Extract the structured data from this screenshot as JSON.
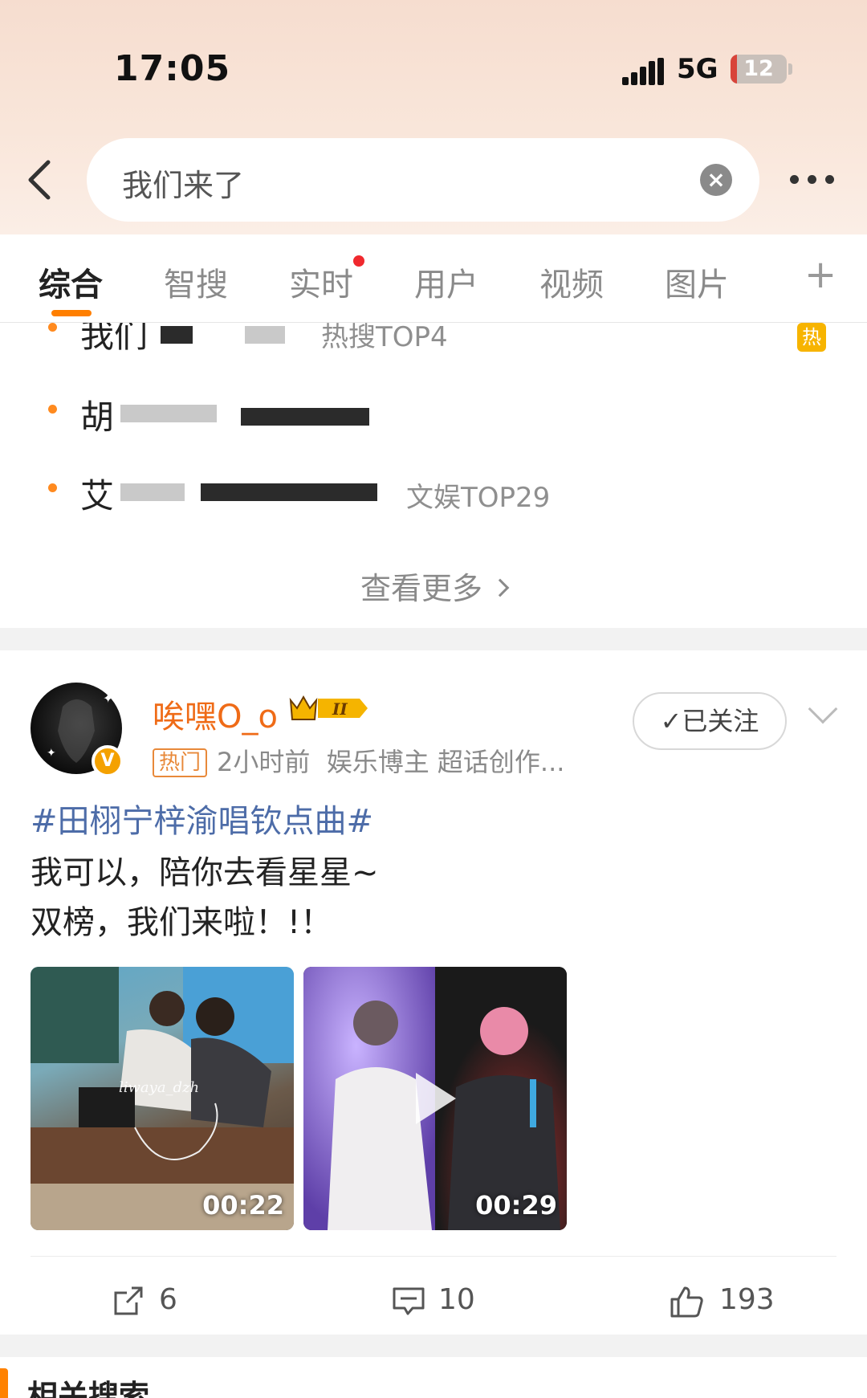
{
  "status_bar": {
    "time": "17:05",
    "network": "5G",
    "battery": "12",
    "battery_percent": 12
  },
  "search": {
    "query": "我们来了",
    "clear_icon": "clear-icon",
    "back_icon": "chevron-left-icon",
    "more_icon": "more-dots-icon"
  },
  "tabs": [
    {
      "label": "综合",
      "active": true
    },
    {
      "label": "智搜"
    },
    {
      "label": "实时",
      "has_dot": true
    },
    {
      "label": "用户"
    },
    {
      "label": "视频"
    },
    {
      "label": "图片"
    }
  ],
  "tabs_add": "+",
  "hot_list": {
    "items": [
      {
        "text": "我们",
        "rank": "热搜TOP4",
        "badge": "热"
      },
      {
        "text": "胡",
        "rank": ""
      },
      {
        "text": "艾",
        "rank": "文娱TOP29"
      }
    ],
    "view_more": "查看更多"
  },
  "post": {
    "username": "唉嘿O_o",
    "level_badge": "II",
    "verified_badge": "V",
    "hot_tag": "热门",
    "time": "2小时前",
    "source": "娱乐博主 超话创作...",
    "follow_label": "✓已关注",
    "topic": "#田栩宁梓渝唱钦点曲#",
    "lines": [
      "我可以，陪你去看星星~",
      "双榜，我们来啦！!！"
    ],
    "videos": [
      {
        "duration": "00:22",
        "watermark": "liwaya_dzh"
      },
      {
        "duration": "00:29"
      }
    ],
    "actions": {
      "repost": "6",
      "comment": "10",
      "like": "193"
    }
  },
  "related": {
    "title": "相关搜索"
  },
  "colors": {
    "accent": "#ff7f00",
    "username": "#ef6b17",
    "topic": "#4d6ca8",
    "hot_badge": "#f7b400"
  }
}
